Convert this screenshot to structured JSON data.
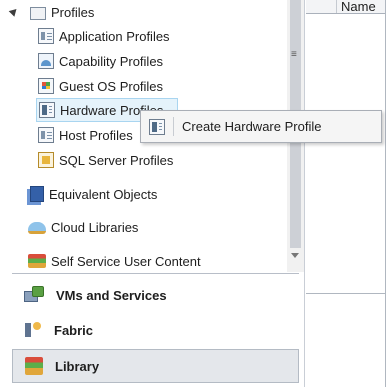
{
  "tree": {
    "profiles": {
      "label": "Profiles",
      "expanded": true
    },
    "items": [
      {
        "label": "Application Profiles",
        "icon": "application-profile-icon"
      },
      {
        "label": "Capability Profiles",
        "icon": "capability-profile-icon"
      },
      {
        "label": "Guest OS Profiles",
        "icon": "guest-os-profile-icon"
      },
      {
        "label": "Hardware Profiles",
        "icon": "hardware-profile-icon"
      },
      {
        "label": "Host Profiles",
        "icon": "host-profile-icon"
      },
      {
        "label": "SQL Server Profiles",
        "icon": "sql-server-profile-icon"
      }
    ],
    "top_level": [
      {
        "label": "Equivalent Objects",
        "icon": "equivalent-objects-icon"
      },
      {
        "label": "Cloud Libraries",
        "icon": "cloud-libraries-icon"
      },
      {
        "label": "Self Service User Content",
        "icon": "self-service-content-icon"
      }
    ]
  },
  "scrollbar": {
    "grip_glyph": "≡"
  },
  "workspaces": [
    {
      "label": "VMs and Services",
      "icon": "vms-services-icon",
      "selected": false
    },
    {
      "label": "Fabric",
      "icon": "fabric-icon",
      "selected": false
    },
    {
      "label": "Library",
      "icon": "library-icon",
      "selected": true
    }
  ],
  "content": {
    "column_header": "Name"
  },
  "context_menu": {
    "items": [
      {
        "label": "Create Hardware Profile",
        "icon": "hardware-profile-icon"
      }
    ]
  },
  "colors": {
    "hover_bg": "#e5f3fb",
    "hover_border": "#a9d5f0",
    "selected_ws": "#e4e7eb"
  }
}
